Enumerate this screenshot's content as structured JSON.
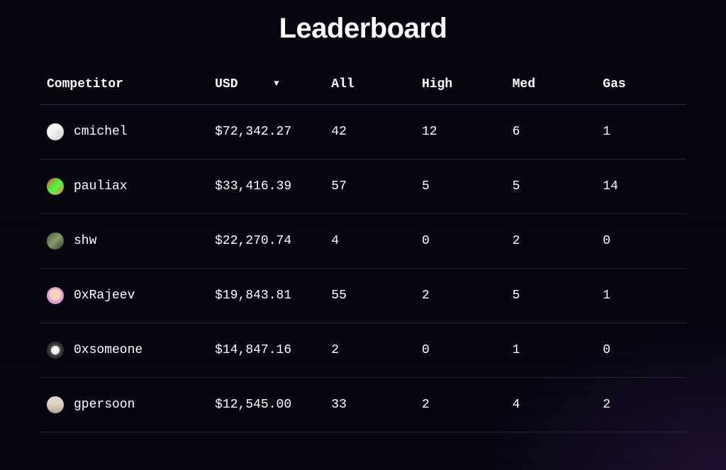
{
  "title": "Leaderboard",
  "headers": {
    "competitor": "Competitor",
    "usd": "USD",
    "all": "All",
    "high": "High",
    "med": "Med",
    "gas": "Gas"
  },
  "sort_indicator": "▼",
  "rows": [
    {
      "name": "cmichel",
      "usd": "$72,342.27",
      "all": "42",
      "high": "12",
      "med": "6",
      "gas": "1",
      "avatar_class": "avatar-1"
    },
    {
      "name": "pauliax",
      "usd": "$33,416.39",
      "all": "57",
      "high": "5",
      "med": "5",
      "gas": "14",
      "avatar_class": "avatar-2"
    },
    {
      "name": "shw",
      "usd": "$22,270.74",
      "all": "4",
      "high": "0",
      "med": "2",
      "gas": "0",
      "avatar_class": "avatar-3"
    },
    {
      "name": "0xRajeev",
      "usd": "$19,843.81",
      "all": "55",
      "high": "2",
      "med": "5",
      "gas": "1",
      "avatar_class": "avatar-4"
    },
    {
      "name": "0xsomeone",
      "usd": "$14,847.16",
      "all": "2",
      "high": "0",
      "med": "1",
      "gas": "0",
      "avatar_class": "avatar-5"
    },
    {
      "name": "gpersoon",
      "usd": "$12,545.00",
      "all": "33",
      "high": "2",
      "med": "4",
      "gas": "2",
      "avatar_class": "avatar-6"
    }
  ]
}
